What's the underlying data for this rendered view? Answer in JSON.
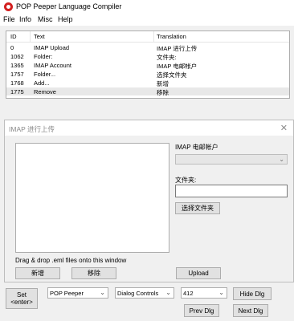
{
  "window": {
    "title": "POP Peeper Language Compiler"
  },
  "menu": {
    "items": [
      "File",
      "Info",
      "Misc",
      "Help"
    ]
  },
  "list": {
    "columns": [
      "ID",
      "Text",
      "Translation"
    ],
    "rows": [
      {
        "id": "0",
        "text": "IMAP Upload",
        "translation": "IMAP 进行上传"
      },
      {
        "id": "1062",
        "text": "Folder:",
        "translation": "文件夹:"
      },
      {
        "id": "1365",
        "text": "IMAP Account",
        "translation": "IMAP 电邮帐户"
      },
      {
        "id": "1757",
        "text": "Folder...",
        "translation": "选择文件夹"
      },
      {
        "id": "1768",
        "text": "Add...",
        "translation": "新增"
      },
      {
        "id": "1775",
        "text": "Remove",
        "translation": "移除"
      }
    ]
  },
  "dialog": {
    "title": "IMAP 进行上传",
    "close": "✕",
    "account_label": "IMAP 电邮帐户",
    "folder_label": "文件夹:",
    "choose_folder_label": "选择文件夹",
    "drop_hint": "Drag & drop .eml files onto this window",
    "add_label": "新增",
    "remove_label": "移除",
    "upload_label": "Upload"
  },
  "bottom": {
    "set_line1": "Set",
    "set_line2": "<enter>",
    "program_select": "POP Peeper",
    "category_select": "Dialog Controls",
    "id_select": "412",
    "hide_label": "Hide Dlg",
    "prev_label": "Prev Dlg",
    "next_label": "Next Dlg"
  },
  "icons": {
    "app": "pop-peeper-app-icon",
    "dropdown": "chevron-down-icon",
    "close": "close-icon"
  }
}
